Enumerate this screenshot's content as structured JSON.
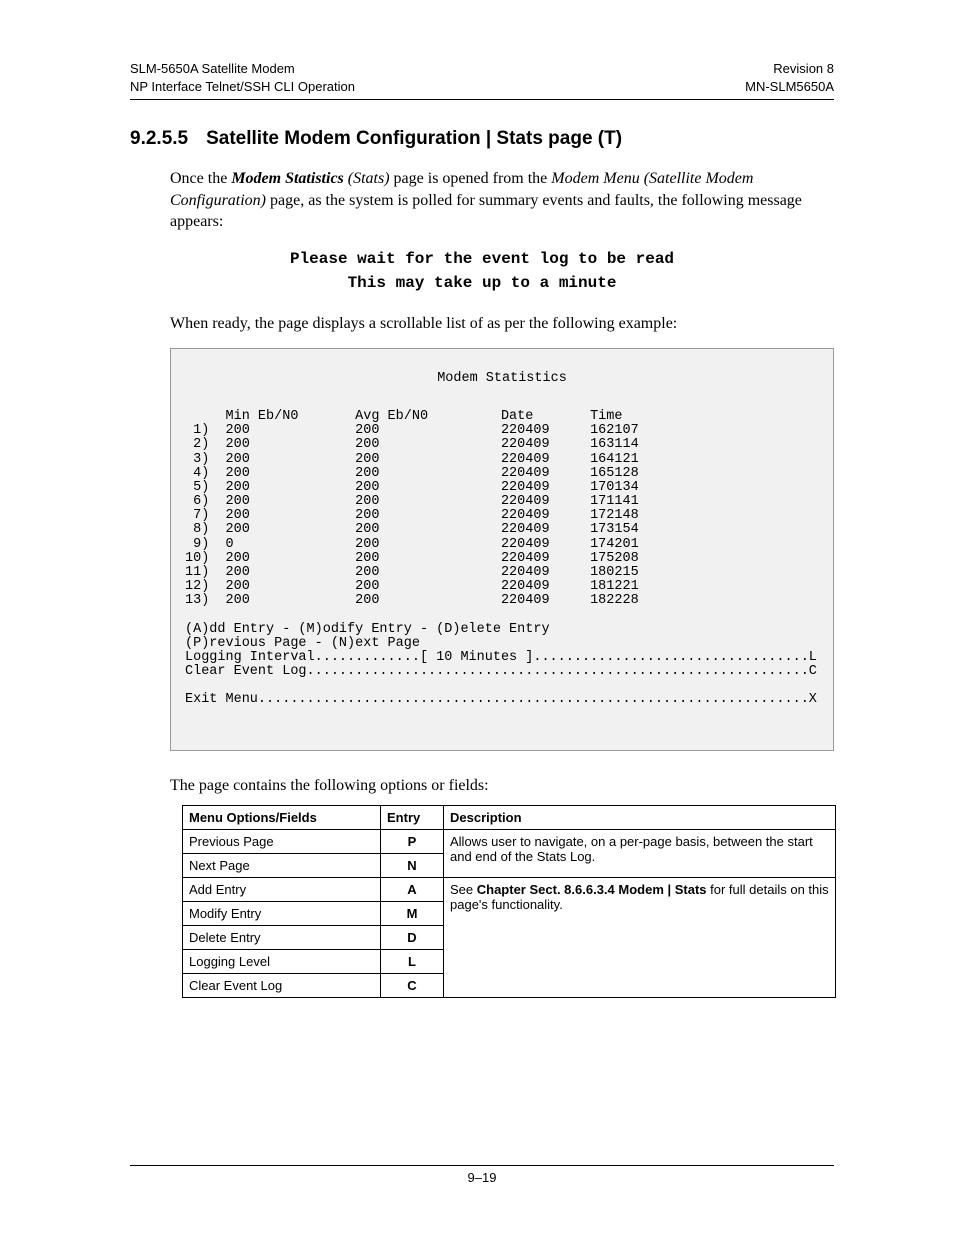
{
  "header": {
    "left_line1": "SLM-5650A Satellite Modem",
    "left_line2": "NP Interface Telnet/SSH CLI Operation",
    "right_line1": "Revision 8",
    "right_line2": "MN-SLM5650A"
  },
  "section": {
    "number": "9.2.5.5",
    "title": "Satellite Modem Configuration | Stats page (T)"
  },
  "intro": {
    "pre": "Once the ",
    "bolditalic": "Modem Statistics",
    "italic1": " (Stats)",
    "mid": " page is opened from the ",
    "italic2": "Modem Menu (Satellite Modem Configuration)",
    "post": " page, as the system is polled for summary events and faults, the following message appears:"
  },
  "wait": {
    "line1": "Please wait for the event log to be read",
    "line2": "This may take up to a minute"
  },
  "ready_text": "When ready, the page displays a scrollable list of as per the following example:",
  "terminal": {
    "title": "Modem Statistics",
    "col_headers": {
      "min": "Min Eb/N0",
      "avg": "Avg Eb/N0",
      "date": "Date",
      "time": "Time"
    },
    "rows": [
      {
        "idx": " 1)",
        "min": "200",
        "avg": "200",
        "date": "220409",
        "time": "162107"
      },
      {
        "idx": " 2)",
        "min": "200",
        "avg": "200",
        "date": "220409",
        "time": "163114"
      },
      {
        "idx": " 3)",
        "min": "200",
        "avg": "200",
        "date": "220409",
        "time": "164121"
      },
      {
        "idx": " 4)",
        "min": "200",
        "avg": "200",
        "date": "220409",
        "time": "165128"
      },
      {
        "idx": " 5)",
        "min": "200",
        "avg": "200",
        "date": "220409",
        "time": "170134"
      },
      {
        "idx": " 6)",
        "min": "200",
        "avg": "200",
        "date": "220409",
        "time": "171141"
      },
      {
        "idx": " 7)",
        "min": "200",
        "avg": "200",
        "date": "220409",
        "time": "172148"
      },
      {
        "idx": " 8)",
        "min": "200",
        "avg": "200",
        "date": "220409",
        "time": "173154"
      },
      {
        "idx": " 9)",
        "min": "0",
        "avg": "200",
        "date": "220409",
        "time": "174201"
      },
      {
        "idx": "10)",
        "min": "200",
        "avg": "200",
        "date": "220409",
        "time": "175208"
      },
      {
        "idx": "11)",
        "min": "200",
        "avg": "200",
        "date": "220409",
        "time": "180215"
      },
      {
        "idx": "12)",
        "min": "200",
        "avg": "200",
        "date": "220409",
        "time": "181221"
      },
      {
        "idx": "13)",
        "min": "200",
        "avg": "200",
        "date": "220409",
        "time": "182228"
      }
    ],
    "menu": {
      "line1": "(A)dd Entry - (M)odify Entry - (D)elete Entry",
      "line2": "(P)revious Page - (N)ext Page",
      "logging": "Logging Interval.............[ 10 Minutes ]..................................L",
      "clear": "Clear Event Log..............................................................C",
      "exit": "Exit Menu....................................................................X"
    }
  },
  "options_intro": "The page contains the following options or fields:",
  "options_table": {
    "headers": {
      "menu": "Menu Options/Fields",
      "entry": "Entry",
      "desc": "Description"
    },
    "group1_desc": "Allows user to navigate, on a per-page basis, between the start and end of the Stats Log.",
    "group2_desc_pre": "See ",
    "group2_desc_bold": "Chapter Sect. 8.6.6.3.4 Modem | Stats",
    "group2_desc_post": " for full details on this page's functionality.",
    "rows": [
      {
        "menu": "Previous Page",
        "entry": "P"
      },
      {
        "menu": "Next Page",
        "entry": "N"
      },
      {
        "menu": "Add Entry",
        "entry": "A"
      },
      {
        "menu": "Modify Entry",
        "entry": "M"
      },
      {
        "menu": "Delete Entry",
        "entry": "D"
      },
      {
        "menu": "Logging Level",
        "entry": "L"
      },
      {
        "menu": "Clear Event Log",
        "entry": "C"
      }
    ]
  },
  "footer": {
    "page": "9–19"
  }
}
